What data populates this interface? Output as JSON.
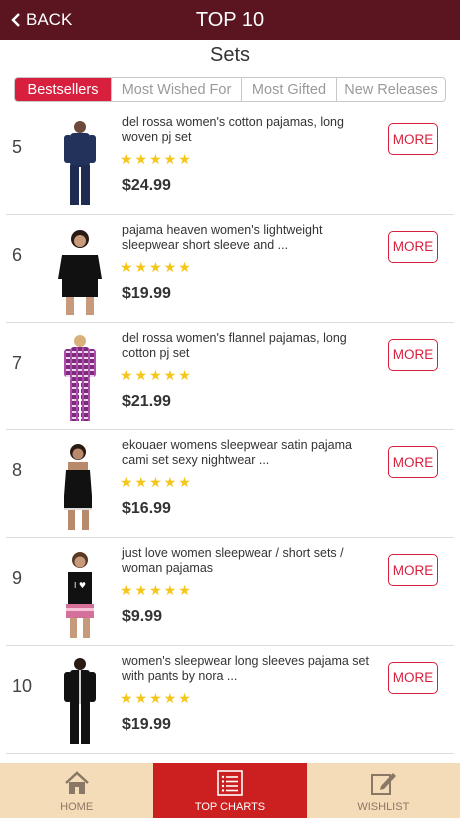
{
  "header": {
    "back_label": "BACK",
    "title": "TOP 10"
  },
  "section_title": "Sets",
  "tabs": [
    {
      "label": "Bestsellers",
      "active": true
    },
    {
      "label": "Most Wished For",
      "active": false
    },
    {
      "label": "Most Gifted",
      "active": false
    },
    {
      "label": "New Releases",
      "active": false
    }
  ],
  "products": [
    {
      "rank": "5",
      "title": "del rossa women's cotton pajamas, long woven pj set",
      "stars": "★★★★★",
      "price": "$24.99",
      "more_label": "MORE",
      "image": "navy-pajama-set"
    },
    {
      "rank": "6",
      "title": "pajama heaven women's lightweight sleepwear short sleeve and ...",
      "stars": "★★★★★",
      "price": "$19.99",
      "more_label": "MORE",
      "image": "black-short-set"
    },
    {
      "rank": "7",
      "title": "del rossa women's flannel pajamas, long cotton pj set",
      "stars": "★★★★★",
      "price": "$21.99",
      "more_label": "MORE",
      "image": "purple-plaid-pajamas"
    },
    {
      "rank": "8",
      "title": "ekouaer womens sleepwear satin pajama cami set sexy nightwear ...",
      "stars": "★★★★★",
      "price": "$16.99",
      "more_label": "MORE",
      "image": "black-satin-cami-set"
    },
    {
      "rank": "9",
      "title": "just love women sleepwear / short sets / woman pajamas",
      "stars": "★★★★★",
      "price": "$9.99",
      "more_label": "MORE",
      "image": "tank-and-shorts-set"
    },
    {
      "rank": "10",
      "title": "women's sleepwear long sleeves pajama set with pants by nora ...",
      "stars": "★★★★★",
      "price": "$19.99",
      "more_label": "MORE",
      "image": "black-long-sleeve-set"
    }
  ],
  "bottom_nav": [
    {
      "label": "HOME",
      "icon": "home-icon",
      "active": false
    },
    {
      "label": "TOP CHARTS",
      "icon": "list-icon",
      "active": true
    },
    {
      "label": "WISHLIST",
      "icon": "edit-icon",
      "active": false
    }
  ],
  "colors": {
    "topbar": "#5a1520",
    "accent": "#d81f3d",
    "stars": "#f5c518",
    "bottombar": "#f5dcb8",
    "nav_active": "#cc1f1f"
  }
}
